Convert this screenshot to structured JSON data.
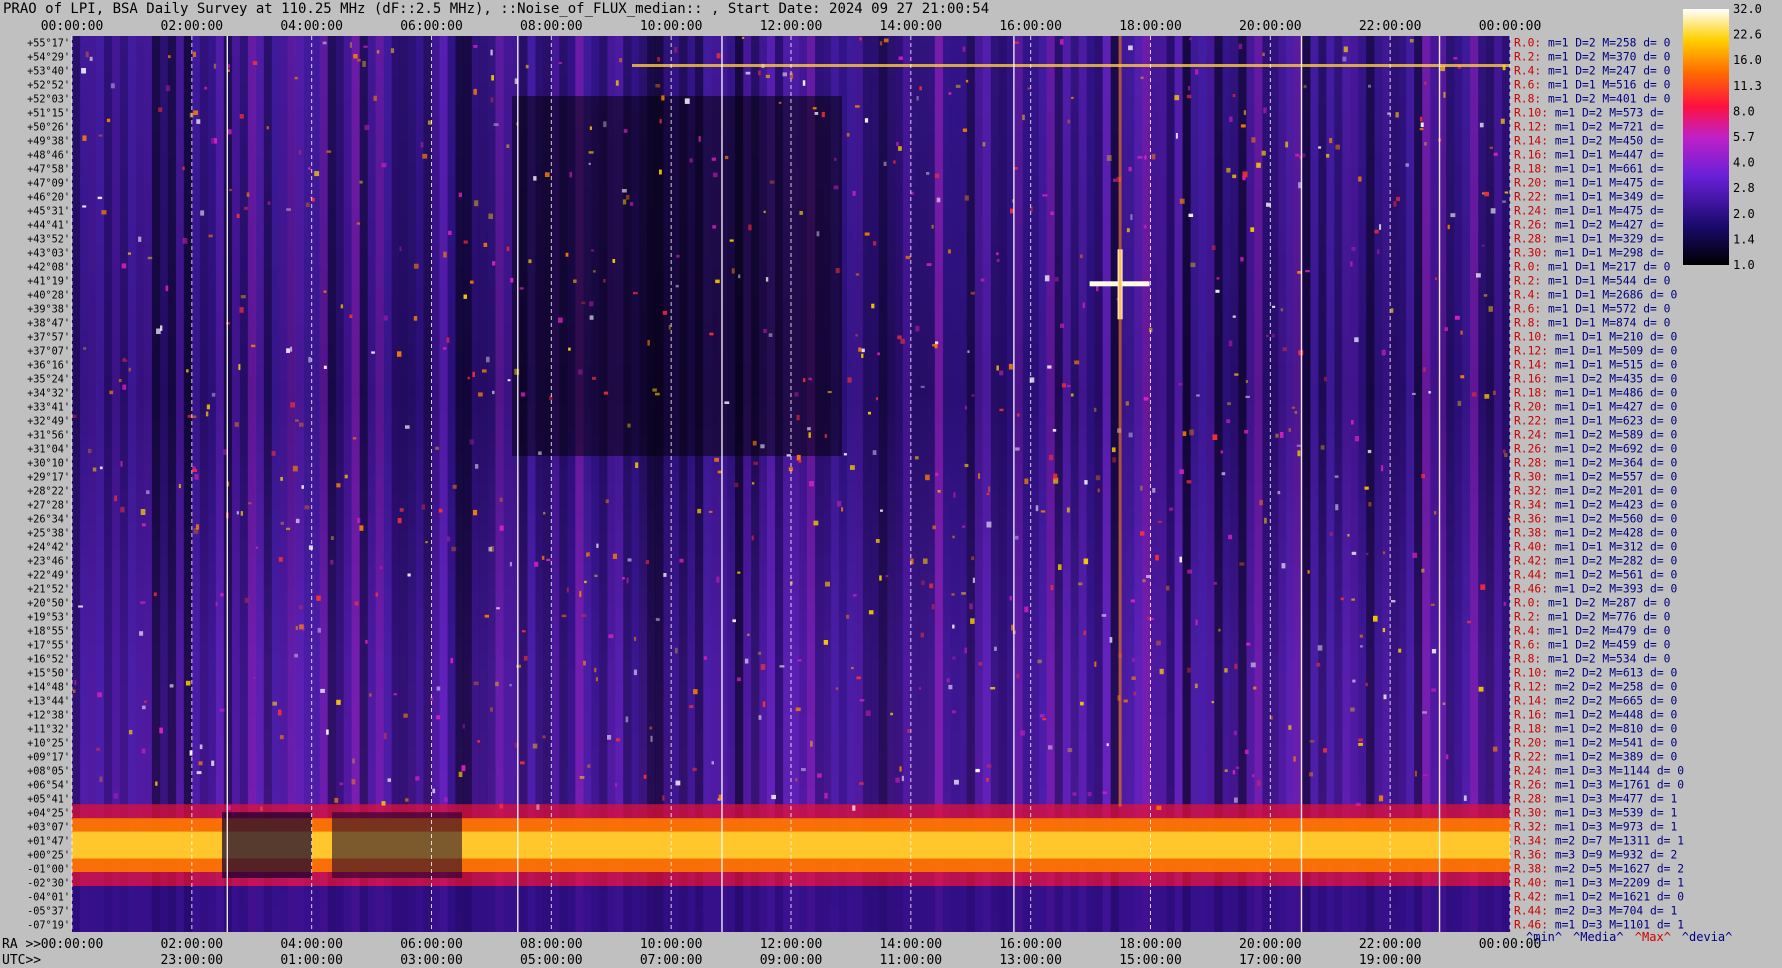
{
  "title": "PRAO of LPI, BSA Daily Survey at 110.25 MHz (dF::2.5 MHz), ::Noise_of_FLUX_median:: , Start Date: 2024 09 27 21:00:54",
  "chart_data": {
    "type": "heatmap",
    "x_top_ticks": [
      "00:00:00",
      "02:00:00",
      "04:00:00",
      "06:00:00",
      "08:00:00",
      "10:00:00",
      "12:00:00",
      "14:00:00",
      "16:00:00",
      "18:00:00",
      "20:00:00",
      "22:00:00",
      "00:00:00"
    ],
    "ra_prefix": "RA >>",
    "ra_bottom_ticks": [
      "00:00:00",
      "02:00:00",
      "04:00:00",
      "06:00:00",
      "08:00:00",
      "10:00:00",
      "12:00:00",
      "14:00:00",
      "16:00:00",
      "18:00:00",
      "20:00:00",
      "22:00:00",
      "00:00:00"
    ],
    "utc_prefix": "UTC>>",
    "utc_ticks": [
      "23:00:00",
      "01:00:00",
      "03:00:00",
      "05:00:00",
      "07:00:00",
      "09:00:00",
      "11:00:00",
      "13:00:00",
      "15:00:00",
      "17:00:00",
      "19:00:00"
    ],
    "dec_labels": [
      "+55°17'",
      "+54°29'",
      "+53°40'",
      "+52°52'",
      "+52°03'",
      "+51°15'",
      "+50°26'",
      "+49°38'",
      "+48°46'",
      "+47°58'",
      "+47°09'",
      "+46°20'",
      "+45°31'",
      "+44°41'",
      "+43°52'",
      "+43°03'",
      "+42°08'",
      "+41°19'",
      "+40°28'",
      "+39°38'",
      "+38°47'",
      "+37°57'",
      "+37°07'",
      "+36°16'",
      "+35°24'",
      "+34°32'",
      "+33°41'",
      "+32°49'",
      "+31°56'",
      "+31°04'",
      "+30°10'",
      "+29°17'",
      "+28°22'",
      "+27°28'",
      "+26°34'",
      "+25°38'",
      "+24°42'",
      "+23°46'",
      "+22°49'",
      "+21°52'",
      "+20°50'",
      "+19°53'",
      "+18°55'",
      "+17°55'",
      "+16°52'",
      "+15°50'",
      "+14°48'",
      "+13°44'",
      "+12°38'",
      "+11°32'",
      "+10°25'",
      "+09°17'",
      "+08°05'",
      "+06°54'",
      "+05°41'",
      "+04°25'",
      "+03°07'",
      "+01°47'",
      "+00°25'",
      "-01°00'",
      "-02°30'",
      "-04°01'",
      "-05°37'",
      "-07°19'"
    ],
    "colorbar": {
      "ticks": [
        "32.0",
        "22.6",
        "16.0",
        "11.3",
        "8.0",
        "5.7",
        "4.0",
        "2.8",
        "2.0",
        "1.4",
        "1.0"
      ],
      "min": 1.0,
      "max": 32.0,
      "scale": "log"
    },
    "right_annotations": [
      "R.0: m=1 D=2 M=258 d= 0",
      "R.2: m=1 D=2 M=370 d= 0",
      "R.4: m=1 D=2 M=247 d= 0",
      "R.6: m=1 D=1 M=516 d= 0",
      "R.8: m=1 D=2 M=401 d= 0",
      "R.10: m=1 D=2 M=573 d=",
      "R.12: m=1 D=2 M=721 d=",
      "R.14: m=1 D=2 M=450 d=",
      "R.16: m=1 D=1 M=447 d=",
      "R.18: m=1 D=1 M=661 d=",
      "R.20: m=1 D=1 M=475 d=",
      "R.22: m=1 D=1 M=349 d=",
      "R.24: m=1 D=1 M=475 d=",
      "R.26: m=1 D=2 M=427 d=",
      "R.28: m=1 D=1 M=329 d=",
      "R.30: m=1 D=1 M=298 d=",
      "R.0: m=1 D=1 M=217 d= 0",
      "R.2: m=1 D=1 M=544 d= 0",
      "R.4: m=1 D=1 M=2686 d= 0",
      "R.6: m=1 D=1 M=572 d= 0",
      "R.8: m=1 D=1 M=874 d= 0",
      "R.10: m=1 D=1 M=210 d= 0",
      "R.12: m=1 D=1 M=509 d= 0",
      "R.14: m=1 D=1 M=515 d= 0",
      "R.16: m=1 D=2 M=435 d= 0",
      "R.18: m=1 D=1 M=486 d= 0",
      "R.20: m=1 D=1 M=427 d= 0",
      "R.22: m=1 D=1 M=623 d= 0",
      "R.24: m=1 D=2 M=589 d= 0",
      "R.26: m=1 D=2 M=692 d= 0",
      "R.28: m=1 D=2 M=364 d= 0",
      "R.30: m=1 D=2 M=557 d= 0",
      "R.32: m=1 D=2 M=201 d= 0",
      "R.34: m=1 D=2 M=423 d= 0",
      "R.36: m=1 D=2 M=560 d= 0",
      "R.38: m=1 D=2 M=428 d= 0",
      "R.40: m=1 D=1 M=312 d= 0",
      "R.42: m=1 D=2 M=282 d= 0",
      "R.44: m=1 D=2 M=561 d= 0",
      "R.46: m=1 D=2 M=393 d= 0",
      "R.0: m=1 D=2 M=287 d= 0",
      "R.2: m=1 D=2 M=776 d= 0",
      "R.4: m=1 D=2 M=479 d= 0",
      "R.6: m=1 D=2 M=459 d= 0",
      "R.8: m=1 D=2 M=534 d= 0",
      "R.10: m=2 D=2 M=613 d= 0",
      "R.12: m=2 D=2 M=258 d= 0",
      "R.14: m=2 D=2 M=665 d= 0",
      "R.16: m=1 D=2 M=448 d= 0",
      "R.18: m=1 D=2 M=810 d= 0",
      "R.20: m=1 D=2 M=541 d= 0",
      "R.22: m=1 D=2 M=389 d= 0",
      "R.24: m=1 D=3 M=1144 d= 0",
      "R.26: m=1 D=3 M=1761 d= 0",
      "R.28: m=1 D=3 M=477 d= 1",
      "R.30: m=1 D=3 M=539 d= 1",
      "R.32: m=1 D=3 M=973 d= 1",
      "R.34: m=2 D=7 M=1311 d= 1",
      "R.36: m=3 D=9 M=932 d= 2",
      "R.38: m=2 D=5 M=1627 d= 2",
      "R.40: m=1 D=3 M=2209 d= 1",
      "R.42: m=1 D=2 M=1621 d= 0",
      "R.44: m=2 D=3 M=704 d= 1",
      "R.46: m=1 D=3 M=1101 d= 1"
    ],
    "footer_legend": [
      "^min^",
      "^Media^",
      "^Max^",
      "^devia^"
    ]
  },
  "colors": {
    "background": "#c0c0c0",
    "annotation_label": "#cc0000",
    "annotation_value": "#000080",
    "legend_max": "#cc0000"
  }
}
